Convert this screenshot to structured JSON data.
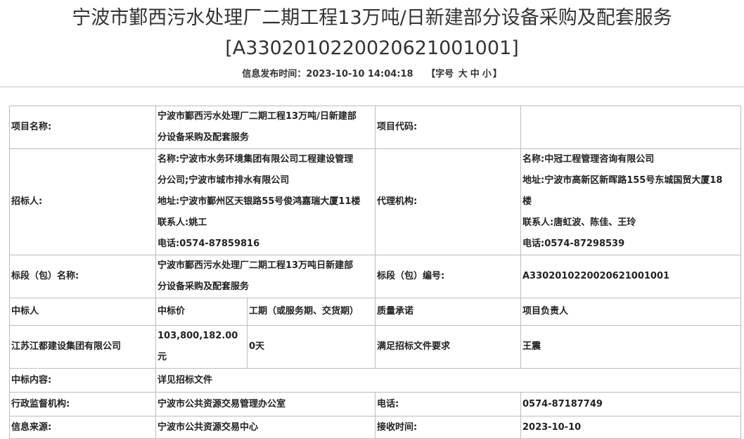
{
  "header": {
    "title_line1": "宁波市鄞西污水处理厂二期工程13万吨/日新建部分设备采购及配套服务",
    "title_line2": "[A3302010220020621001001]",
    "publish_label": "信息发布时间：",
    "publish_time": "2023-10-10 14:04:18",
    "font_size_open": "【字号",
    "font_size_large": "大",
    "font_size_medium": "中",
    "font_size_small": "小",
    "font_size_close": "】"
  },
  "rows": {
    "project_name_label": "项目名称:",
    "project_name_line1": "宁波市鄞西污水处理厂二期工程13万吨/日新建部",
    "project_name_line2": "分设备采购及配套服务",
    "project_code_label": "项目代码:",
    "project_code_value": "",
    "tenderer_label": "招标人:",
    "tenderer_name_line1": "名称:宁波市水务环境集团有限公司工程建设管理",
    "tenderer_name_line2": "分公司;宁波市城市排水有限公司",
    "tenderer_address": "地址:宁波市鄞州区天银路55号俊鸿嘉瑞大厦11楼",
    "tenderer_contact": "联系人:姚工",
    "tenderer_phone": "电话:0574-87859816",
    "agency_label": "代理机构:",
    "agency_name": "名称:中冠工程管理咨询有限公司",
    "agency_address_line1": "地址:宁波市高新区新晖路155号东城国贸大厦18",
    "agency_address_line2": "楼",
    "agency_contact": "联系人:唐虹波、陈佳、王玲",
    "agency_phone": "电话:0574-87298539",
    "section_name_label": "标段（包）名称:",
    "section_name_line1": "宁波市鄞西污水处理厂二期工程13万吨日新建部",
    "section_name_line2": "分设备采购及配套服务",
    "section_code_label": "标段（包）编号:",
    "section_code_value": "A3302010220020621001001",
    "winner_header": "中标人",
    "price_header": "中标价",
    "period_header": "工期（或服务期、交货期）",
    "quality_header": "质量承诺",
    "manager_header": "项目负责人",
    "winner_value": "江苏江都建设集团有限公司",
    "price_value": "103,800,182.00元",
    "period_value": "0天",
    "quality_value": "满足招标文件要求",
    "manager_value": "王震",
    "content_label": "中标内容:",
    "content_value": "详见招标文件",
    "supervisor_label": "行政监督机构:",
    "supervisor_value": "宁波市公共资源交易管理办公室",
    "tel_label": "电话:",
    "tel_value": "0574-87187749",
    "source_label": "信息来源:",
    "source_value": "宁波市公共资源交易中心",
    "received_label": "接收时间:",
    "received_value": "2023-10-10"
  },
  "colors": {
    "label_blue": "#3b6ea8",
    "border": "#bcbcbc",
    "text": "#222222"
  }
}
